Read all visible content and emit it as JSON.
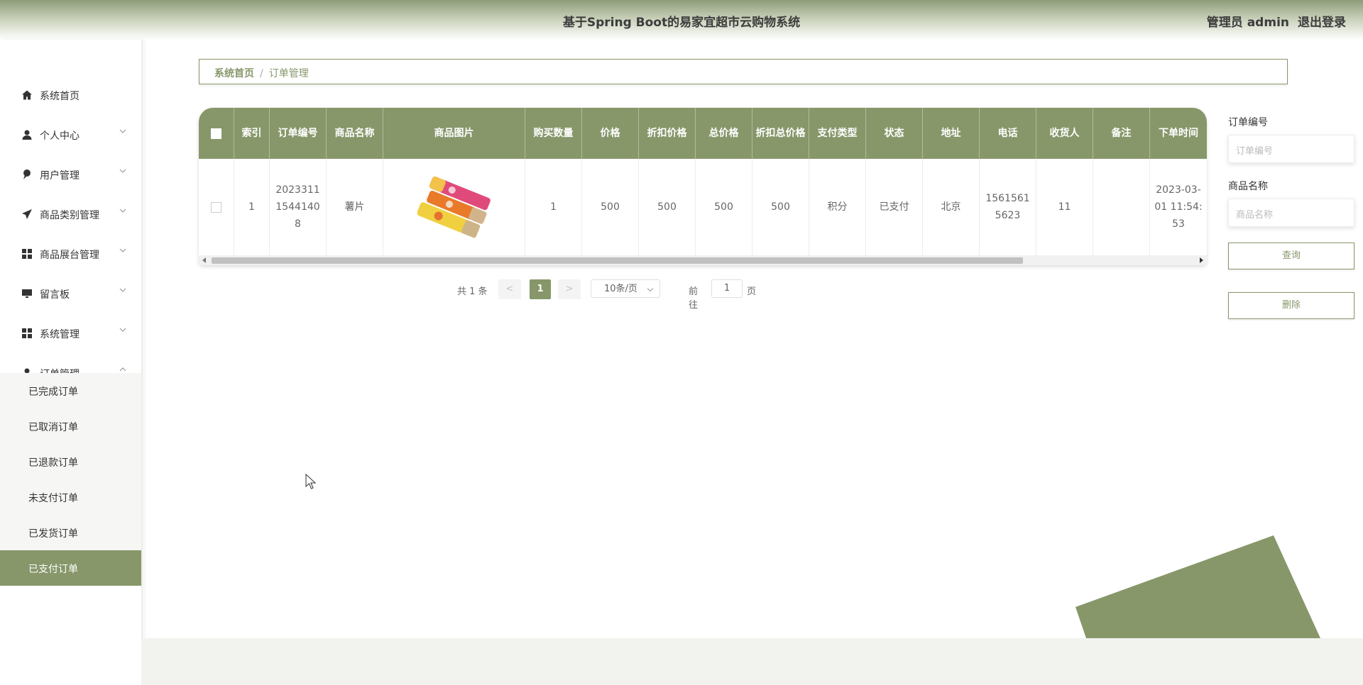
{
  "header": {
    "title": "基于Spring Boot的易家宜超市云购物系统",
    "user_label": "管理员 admin",
    "logout_label": "退出登录"
  },
  "sidebar": {
    "items": [
      {
        "label": "系统首页",
        "icon": "home-icon"
      },
      {
        "label": "个人中心",
        "icon": "user-icon"
      },
      {
        "label": "用户管理",
        "icon": "pin-icon"
      },
      {
        "label": "商品类别管理",
        "icon": "send-icon"
      },
      {
        "label": "商品展台管理",
        "icon": "grid-icon"
      },
      {
        "label": "留言板",
        "icon": "monitor-icon"
      },
      {
        "label": "系统管理",
        "icon": "grid-icon"
      },
      {
        "label": "订单管理",
        "icon": "user-icon"
      }
    ],
    "submenu": [
      {
        "label": "已完成订单"
      },
      {
        "label": "已取消订单"
      },
      {
        "label": "已退款订单"
      },
      {
        "label": "未支付订单"
      },
      {
        "label": "已发货订单"
      },
      {
        "label": "已支付订单",
        "active": true
      }
    ]
  },
  "breadcrumb": {
    "home": "系统首页",
    "separator": "/",
    "current": "订单管理"
  },
  "table": {
    "columns": [
      "索引",
      "订单编号",
      "商品名称",
      "商品图片",
      "购买数量",
      "价格",
      "折扣价格",
      "总价格",
      "折扣总价格",
      "支付类型",
      "状态",
      "地址",
      "电话",
      "收货人",
      "备注",
      "下单时间"
    ],
    "rows": [
      {
        "index": "1",
        "order_no": "20233111544140 8",
        "product_name": "薯片",
        "product_image": "chips-product-image",
        "quantity": "1",
        "price": "500",
        "discount_price": "500",
        "total_price": "500",
        "discount_total": "500",
        "pay_type": "积分",
        "status": "已支付",
        "address": "北京",
        "phone": "15615615623",
        "receiver": "11",
        "note": "",
        "order_time": "2023-03-01 11:54:53"
      }
    ]
  },
  "pagination": {
    "total": "共 1 条",
    "prev": "<",
    "current_page": "1",
    "next": ">",
    "page_size": "10条/页",
    "goto_label": "前往",
    "goto_value": "1",
    "page_label": "页"
  },
  "search": {
    "order_no_label": "订单编号",
    "order_no_placeholder": "订单编号",
    "product_name_label": "商品名称",
    "product_name_placeholder": "商品名称",
    "query_button": "查询",
    "delete_button": "删除"
  },
  "colors": {
    "accent": "#87976a",
    "header_start": "#8e9c78"
  }
}
